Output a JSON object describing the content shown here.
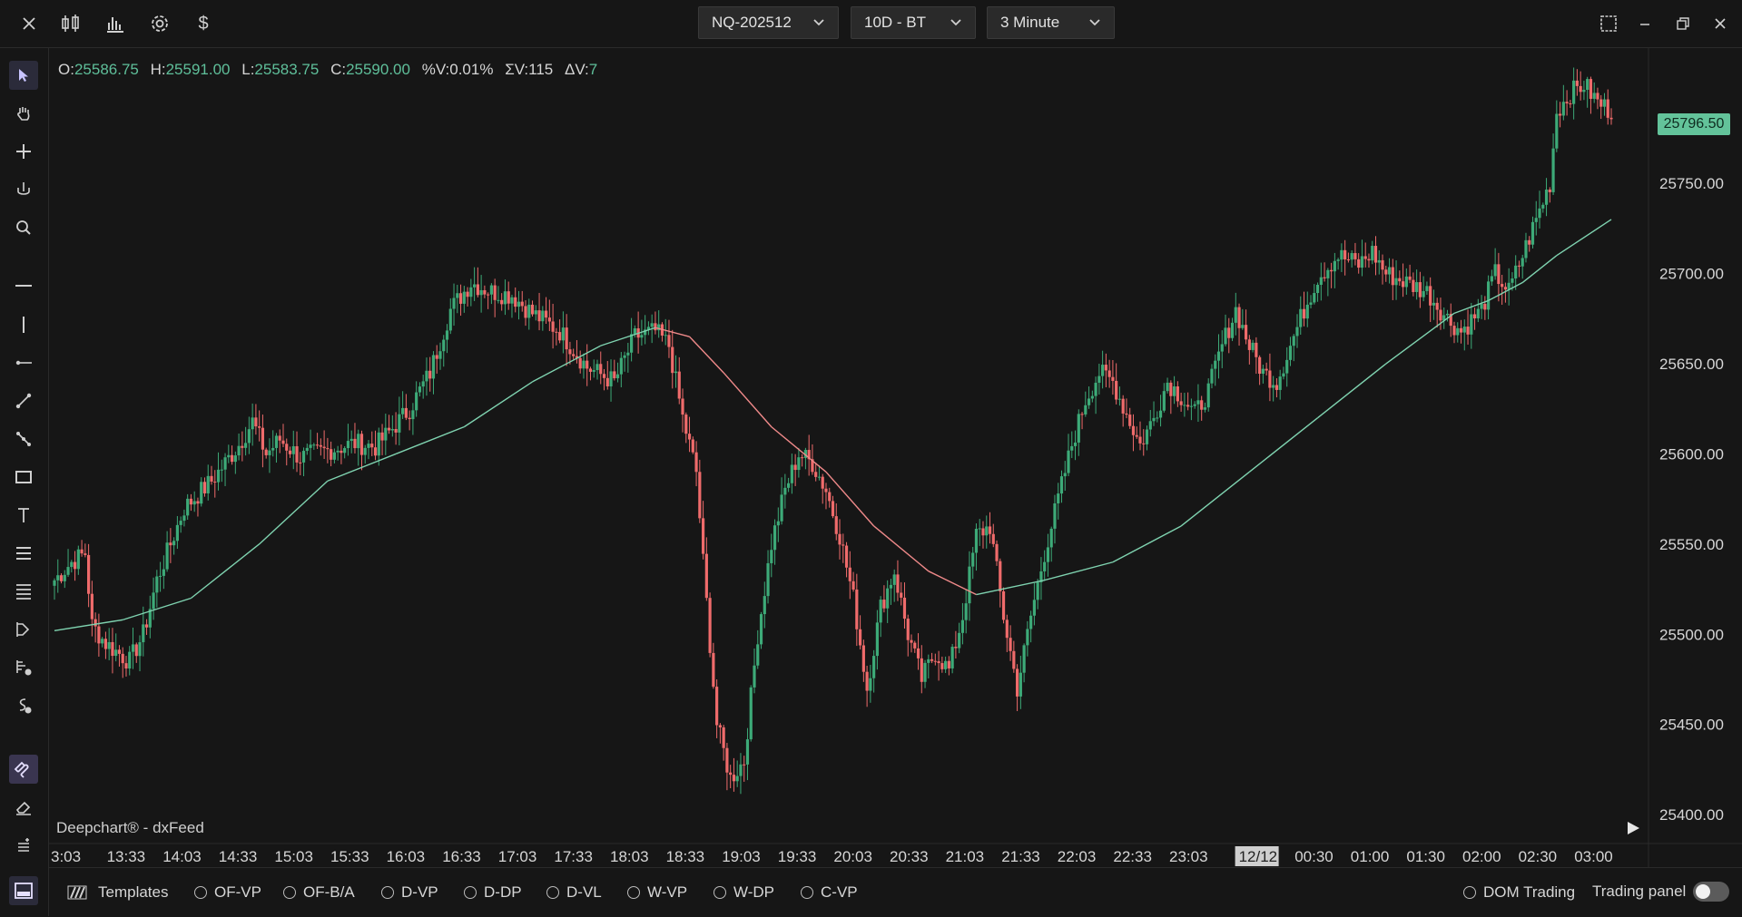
{
  "topbar": {
    "close_icon": "close-icon",
    "tool_icons": [
      "candlestick-icon",
      "bar-chart-icon",
      "gear-icon",
      "dollar-icon"
    ],
    "symbol": "NQ-202512",
    "range": "10D - BT",
    "interval": "3 Minute",
    "window_icons": [
      "layout-icon",
      "minimize-icon",
      "restore-icon",
      "close-icon"
    ]
  },
  "left_toolbar": {
    "tools": [
      "cursor-icon",
      "hand-icon",
      "crosshair-icon",
      "magnet-cursor-icon",
      "zoom-icon",
      "horizontal-line-icon",
      "vertical-line-icon",
      "ray-icon",
      "trend-line-icon",
      "path-icon",
      "rectangle-icon",
      "text-icon",
      "fib-icon",
      "levels-icon",
      "order-flow-icon",
      "volume-profile-icon",
      "session-icon",
      "magnet-icon",
      "eraser-icon",
      "stack-icon"
    ]
  },
  "ohlc": {
    "o_label": "O:",
    "o": "25586.75",
    "h_label": "H:",
    "h": "25591.00",
    "l_label": "L:",
    "l": "25583.75",
    "c_label": "C:",
    "c": "25590.00",
    "pv_label": "%V:",
    "pv": "0.01%",
    "sv_label": "ΣV:",
    "sv": "115",
    "dv_label": "ΔV:",
    "dv": "7"
  },
  "watermark": "Deepchart® - dxFeed",
  "current_price": "25796.50",
  "colors": {
    "up": "#3daa78",
    "down": "#ef6b6b",
    "ma_up": "#7fd3b0",
    "ma_down": "#f08a8a",
    "price_tag": "#63c39a"
  },
  "chart_data": {
    "type": "candlestick",
    "ylim": [
      25390,
      25820
    ],
    "y_ticks": [
      "25796.50",
      "25750.00",
      "25700.00",
      "25650.00",
      "25600.00",
      "25550.00",
      "25500.00",
      "25450.00",
      "25400.00"
    ],
    "x_ticks": [
      "3:03",
      "13:33",
      "14:03",
      "14:33",
      "15:03",
      "15:33",
      "16:03",
      "16:33",
      "17:03",
      "17:33",
      "18:03",
      "18:33",
      "19:03",
      "19:33",
      "20:03",
      "20:33",
      "21:03",
      "21:33",
      "22:03",
      "22:33",
      "23:03",
      "12/12",
      "00:30",
      "01:00",
      "01:30",
      "02:00",
      "02:30",
      "03:00"
    ],
    "highlight_tick": "12/12",
    "anchors": [
      [
        0,
        25530
      ],
      [
        5,
        25540
      ],
      [
        9,
        25545
      ],
      [
        11,
        25505
      ],
      [
        15,
        25495
      ],
      [
        22,
        25485
      ],
      [
        26,
        25500
      ],
      [
        30,
        25530
      ],
      [
        38,
        25570
      ],
      [
        46,
        25585
      ],
      [
        54,
        25605
      ],
      [
        58,
        25618
      ],
      [
        62,
        25600
      ],
      [
        66,
        25608
      ],
      [
        72,
        25598
      ],
      [
        80,
        25602
      ],
      [
        88,
        25606
      ],
      [
        94,
        25604
      ],
      [
        98,
        25612
      ],
      [
        104,
        25625
      ],
      [
        110,
        25645
      ],
      [
        116,
        25680
      ],
      [
        122,
        25695
      ],
      [
        128,
        25690
      ],
      [
        134,
        25688
      ],
      [
        140,
        25678
      ],
      [
        148,
        25668
      ],
      [
        156,
        25648
      ],
      [
        164,
        25640
      ],
      [
        170,
        25665
      ],
      [
        176,
        25668
      ],
      [
        180,
        25660
      ],
      [
        184,
        25620
      ],
      [
        188,
        25590
      ],
      [
        190,
        25540
      ],
      [
        194,
        25450
      ],
      [
        198,
        25420
      ],
      [
        202,
        25430
      ],
      [
        206,
        25500
      ],
      [
        210,
        25550
      ],
      [
        214,
        25580
      ],
      [
        218,
        25600
      ],
      [
        222,
        25595
      ],
      [
        226,
        25580
      ],
      [
        230,
        25555
      ],
      [
        234,
        25520
      ],
      [
        238,
        25470
      ],
      [
        242,
        25515
      ],
      [
        246,
        25535
      ],
      [
        250,
        25500
      ],
      [
        254,
        25475
      ],
      [
        258,
        25490
      ],
      [
        262,
        25480
      ],
      [
        266,
        25510
      ],
      [
        270,
        25555
      ],
      [
        274,
        25560
      ],
      [
        278,
        25510
      ],
      [
        282,
        25470
      ],
      [
        286,
        25510
      ],
      [
        290,
        25545
      ],
      [
        294,
        25575
      ],
      [
        298,
        25605
      ],
      [
        302,
        25630
      ],
      [
        306,
        25645
      ],
      [
        310,
        25640
      ],
      [
        314,
        25622
      ],
      [
        318,
        25605
      ],
      [
        322,
        25620
      ],
      [
        326,
        25640
      ],
      [
        330,
        25632
      ],
      [
        334,
        25622
      ],
      [
        338,
        25635
      ],
      [
        342,
        25660
      ],
      [
        346,
        25680
      ],
      [
        350,
        25660
      ],
      [
        354,
        25645
      ],
      [
        358,
        25640
      ],
      [
        362,
        25660
      ],
      [
        366,
        25680
      ],
      [
        370,
        25698
      ],
      [
        376,
        25710
      ],
      [
        382,
        25705
      ],
      [
        386,
        25712
      ],
      [
        390,
        25700
      ],
      [
        396,
        25695
      ],
      [
        402,
        25690
      ],
      [
        408,
        25675
      ],
      [
        412,
        25668
      ],
      [
        418,
        25680
      ],
      [
        422,
        25700
      ],
      [
        426,
        25690
      ],
      [
        430,
        25710
      ],
      [
        434,
        25730
      ],
      [
        438,
        25750
      ],
      [
        440,
        25790
      ],
      [
        444,
        25800
      ],
      [
        448,
        25805
      ],
      [
        452,
        25795
      ],
      [
        456,
        25790
      ]
    ],
    "ma_points": [
      [
        0,
        25502
      ],
      [
        20,
        25508
      ],
      [
        40,
        25520
      ],
      [
        60,
        25550
      ],
      [
        80,
        25585
      ],
      [
        100,
        25600
      ],
      [
        120,
        25615
      ],
      [
        140,
        25640
      ],
      [
        160,
        25660
      ],
      [
        176,
        25670
      ],
      [
        186,
        25665
      ],
      [
        196,
        25645
      ],
      [
        210,
        25615
      ],
      [
        226,
        25590
      ],
      [
        240,
        25560
      ],
      [
        256,
        25535
      ],
      [
        270,
        25522
      ],
      [
        290,
        25530
      ],
      [
        310,
        25540
      ],
      [
        330,
        25560
      ],
      [
        350,
        25590
      ],
      [
        370,
        25620
      ],
      [
        390,
        25650
      ],
      [
        410,
        25678
      ],
      [
        420,
        25685
      ],
      [
        430,
        25695
      ],
      [
        440,
        25710
      ],
      [
        456,
        25730
      ]
    ]
  },
  "bottombar": {
    "templates_icon": "templates-icon",
    "templates": "Templates",
    "options": [
      "OF-VP",
      "OF-B/A",
      "D-VP",
      "D-DP",
      "D-VL",
      "W-VP",
      "W-DP",
      "C-VP"
    ],
    "dom_trading": "DOM Trading",
    "trading_panel": "Trading panel"
  }
}
